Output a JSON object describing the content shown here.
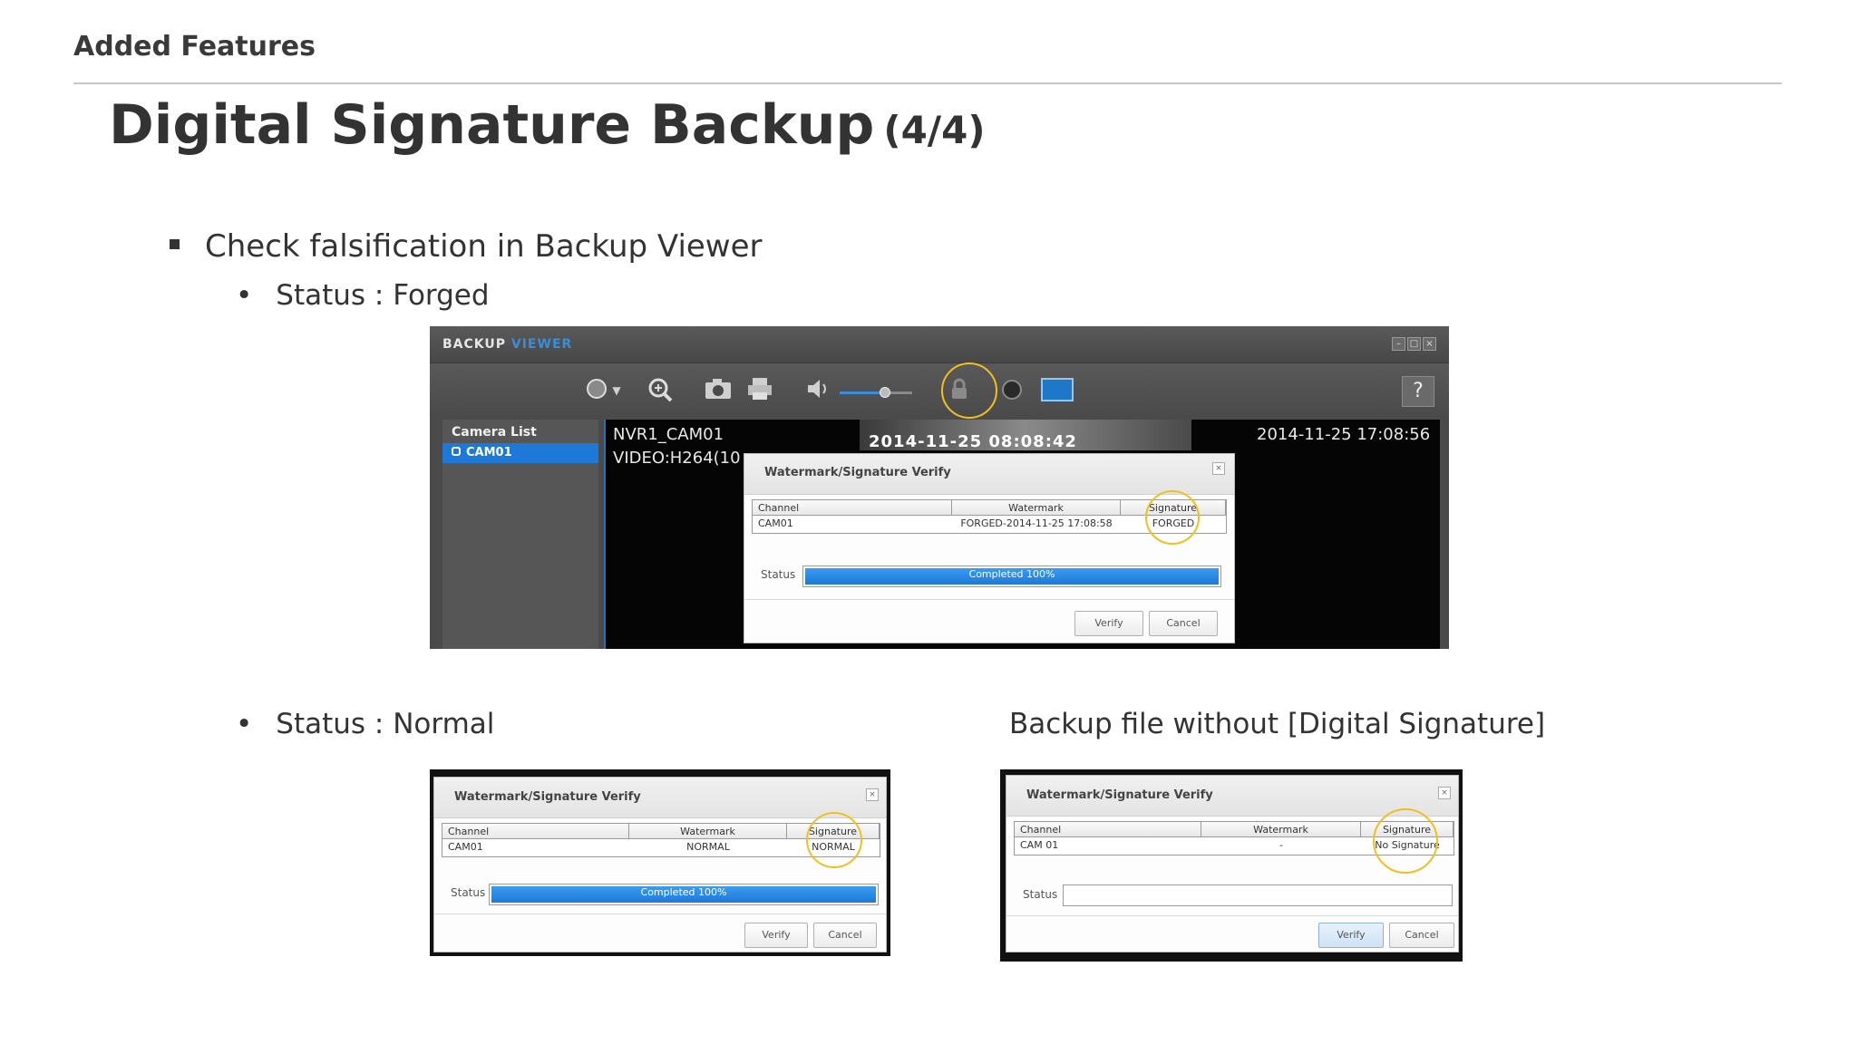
{
  "header": {
    "section": "Added Features",
    "title": "Digital Signature Backup",
    "title_suffix": "(4/4)"
  },
  "bullets": {
    "main": "Check falsification in Backup Viewer",
    "forged": "Status : Forged",
    "normal": "Status : Normal",
    "nosig_caption": "Backup file without [Digital Signature]"
  },
  "viewer": {
    "title_a": "BACKUP",
    "title_b": "VIEWER",
    "window_buttons": [
      "minimize-icon",
      "maximize-icon",
      "close-icon"
    ],
    "toolbar_icons": [
      "record-icon",
      "dropdown-arrow-icon",
      "zoom-in-icon",
      "camera-icon",
      "printer-icon",
      "speaker-icon",
      "volume-slider",
      "lock-verify-icon",
      "record-dot-icon",
      "monitor-icon",
      "help-icon"
    ],
    "help_label": "?",
    "volume_level": 0.62,
    "camera_list": {
      "title": "Camera List",
      "items": [
        "CAM01"
      ]
    },
    "osd": {
      "channel": "NVR1_CAM01",
      "codec": "VIDEO:H264(10",
      "stamp": "2014-11-25  08:08:42",
      "time": "2014-11-25 17:08:56"
    }
  },
  "dialogs": {
    "forged": {
      "title": "Watermark/Signature Verify",
      "columns": [
        "Channel",
        "Watermark",
        "Signature"
      ],
      "row": [
        "CAM01",
        "FORGED-2014-11-25 17:08:58",
        "FORGED"
      ],
      "status_label": "Status",
      "progress_text": "Completed 100%",
      "progress": 1.0,
      "buttons": [
        "Verify",
        "Cancel"
      ]
    },
    "normal": {
      "title": "Watermark/Signature Verify",
      "columns": [
        "Channel",
        "Watermark",
        "Signature"
      ],
      "row": [
        "CAM01",
        "NORMAL",
        "NORMAL"
      ],
      "status_label": "Status",
      "progress_text": "Completed 100%",
      "progress": 1.0,
      "buttons": [
        "Verify",
        "Cancel"
      ]
    },
    "nosig": {
      "title": "Watermark/Signature Verify",
      "columns": [
        "Channel",
        "Watermark",
        "Signature"
      ],
      "row": [
        "CAM 01",
        "-",
        "No Signature"
      ],
      "status_label": "Status",
      "progress_text": "",
      "progress": 0,
      "buttons": [
        "Verify",
        "Cancel"
      ]
    }
  },
  "colors": {
    "accent_blue": "#1e78d8",
    "highlight_circle": "#f0c020"
  }
}
